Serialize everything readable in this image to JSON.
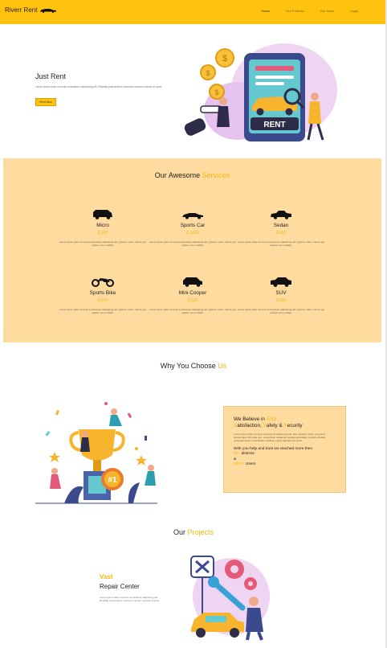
{
  "nav": {
    "brand": "Riverr Rent",
    "links": [
      {
        "label": "Home",
        "active": true
      },
      {
        "label": "Our Portfolio",
        "active": false
      },
      {
        "label": "Our Team",
        "active": false
      },
      {
        "label": "Login",
        "active": false
      }
    ]
  },
  "hero": {
    "title": "Just Rent",
    "text": "Lorem ipsum dolor sit amet consectetur adipisicing elit. Repellat praesentium inventore veniam corporis id quos.",
    "button": "Rent Now",
    "illustration_label": "RENT"
  },
  "services": {
    "title_prefix": "Our Awesome ",
    "title_accent": "Services",
    "items": [
      {
        "name": "Micro",
        "price": "$ 350",
        "icon": "micro-car-icon",
        "desc": "Lorem ipsum dolor sit amet consectetur adipisicing elit. Quamsi, ullam. Nemo quo quidem cum mollitia."
      },
      {
        "name": "Sports Car",
        "price": "$ 1000",
        "icon": "sports-car-icon",
        "desc": "Lorem ipsum dolor sit amet consectetur adipisicing elit. Quamsi, ullam. Nemo quo quidem cum mollitia."
      },
      {
        "name": "Sedan",
        "price": "$ 600",
        "icon": "sedan-icon",
        "desc": "Lorem ipsum dolor sit amet consectetur adipisicing elit. Quamsi, ullam. Nemo quo quidem cum mollitia."
      },
      {
        "name": "Sports Bike",
        "price": "$ 650",
        "icon": "motorbike-icon",
        "desc": "Lorem ipsum dolor sit amet consectetur adipisicing elit. Quamsi, ullam. Nemo quo quidem cum mollitia."
      },
      {
        "name": "Mini Cooper",
        "price": "$ 530",
        "icon": "mini-cooper-icon",
        "desc": "Lorem ipsum dolor sit amet consectetur adipisicing elit. Quamsi, ullam. Nemo quo quidem cum mollitia."
      },
      {
        "name": "SUV",
        "price": "$ 600",
        "icon": "suv-icon",
        "desc": "Lorem ipsum dolor sit amet consectetur adipisicing elit. Quamsi, ullam. Nemo quo quidem cum mollitia."
      }
    ]
  },
  "why": {
    "title_prefix": "Why You Choose ",
    "title_accent": "Us",
    "believe_prefix": "We Believe in ",
    "believe_acronym": "SSS",
    "s1_letter": "S",
    "s1_rest": "atisfaction, ",
    "s2_letter": "S",
    "s2_rest": "afety & ",
    "s3_letter": "S",
    "s3_rest": "ecurity",
    "text": "Lorem ipsum dolor sit amet consectetur adipisicing elit. Rem quaerat minim, qui ipsum doloremque nihil vitae quo, consectetur obcaecati repellat quibusdam ut ullam. Debitis quisquam ipsum voluptatibus similique eaque dignissimos quasi.",
    "reach_text": "With you help and trust we reached more then",
    "districts_num": "50+",
    "districts_label": " districts",
    "amp": "&",
    "users_num": "5000+",
    "users_label": " Users"
  },
  "projects": {
    "title_prefix": "Our ",
    "title_accent": "Projects",
    "accent_word": "Vast",
    "heading": "Repair Center",
    "text": "Lorem ipsum dolor sit amet consectetur adipisicing elit. Repellat praesentium inventore veniam corporis id quos."
  },
  "colors": {
    "accent": "#ffc20e",
    "accent_text": "#f5b70d",
    "panel": "#ffdba0"
  }
}
